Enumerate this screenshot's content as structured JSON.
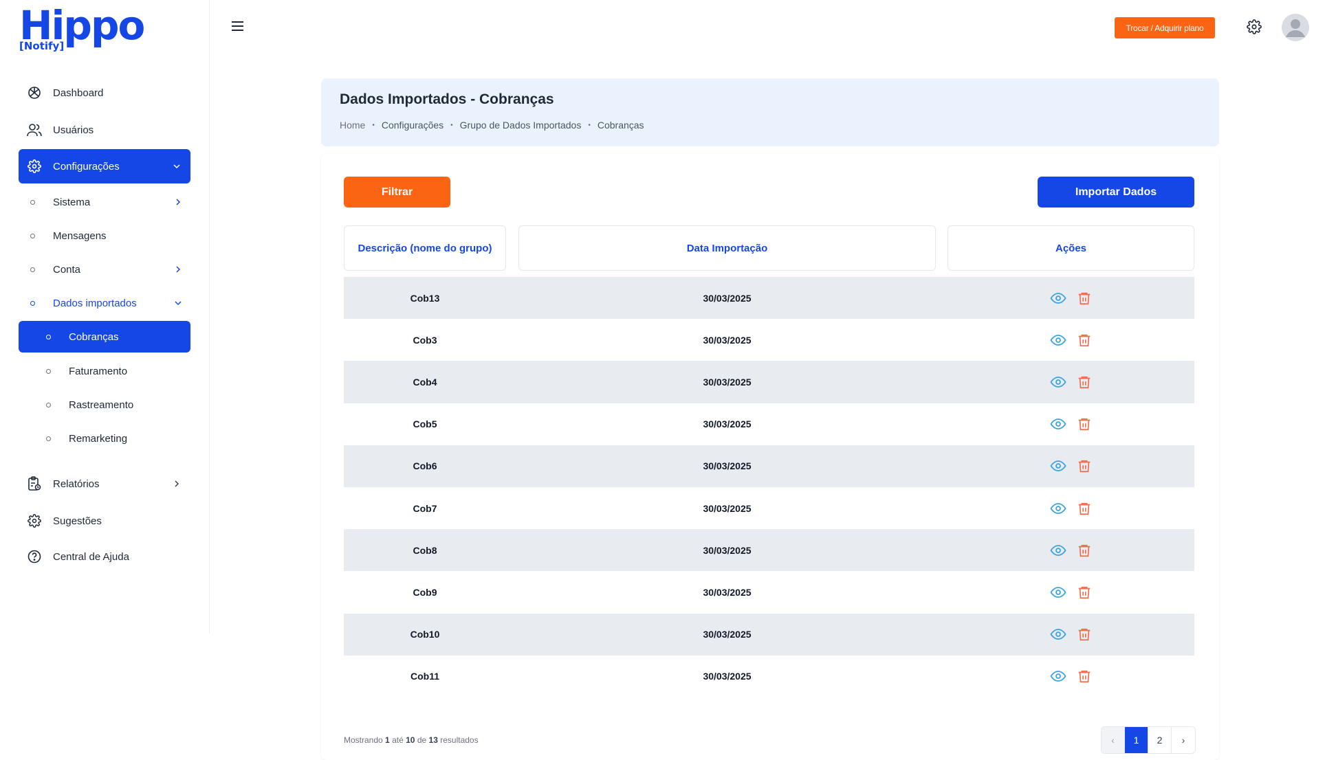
{
  "logo": {
    "main": "Hippo",
    "sub": "[Notify]"
  },
  "sidebar": {
    "items": [
      {
        "label": "Dashboard",
        "icon": "dashboard-icon"
      },
      {
        "label": "Usuários",
        "icon": "users-icon"
      },
      {
        "label": "Configurações",
        "icon": "gear-icon",
        "active": true,
        "expanded": true
      },
      {
        "label": "Relatórios",
        "icon": "report-icon"
      },
      {
        "label": "Sugestões",
        "icon": "suggestion-gear-icon"
      },
      {
        "label": "Central de Ajuda",
        "icon": "help-icon"
      }
    ],
    "config_sub": [
      {
        "label": "Sistema"
      },
      {
        "label": "Mensagens"
      },
      {
        "label": "Conta"
      },
      {
        "label": "Dados importados",
        "expanded": true
      }
    ],
    "imported_sub": [
      {
        "label": "Cobranças",
        "active": true
      },
      {
        "label": "Faturamento"
      },
      {
        "label": "Rastreamento"
      },
      {
        "label": "Remarketing"
      }
    ]
  },
  "topbar": {
    "upgrade_label": "Trocar / Adquirir plano"
  },
  "header": {
    "title": "Dados Importados - Cobranças",
    "breadcrumb": [
      "Home",
      "Configurações",
      "Grupo de Dados Importados",
      "Cobranças"
    ]
  },
  "actions": {
    "filter_label": "Filtrar",
    "import_label": "Importar Dados"
  },
  "table": {
    "headers": [
      "Descrição (nome do grupo)",
      "Data Importação",
      "Ações"
    ],
    "rows": [
      {
        "name": "Cob13",
        "date": "30/03/2025"
      },
      {
        "name": "Cob3",
        "date": "30/03/2025"
      },
      {
        "name": "Cob4",
        "date": "30/03/2025"
      },
      {
        "name": "Cob5",
        "date": "30/03/2025"
      },
      {
        "name": "Cob6",
        "date": "30/03/2025"
      },
      {
        "name": "Cob7",
        "date": "30/03/2025"
      },
      {
        "name": "Cob8",
        "date": "30/03/2025"
      },
      {
        "name": "Cob9",
        "date": "30/03/2025"
      },
      {
        "name": "Cob10",
        "date": "30/03/2025"
      },
      {
        "name": "Cob11",
        "date": "30/03/2025"
      }
    ]
  },
  "pagination": {
    "showing_prefix": "Mostrando",
    "from": "1",
    "to_word": "até",
    "to": "10",
    "of_word": "de",
    "total": "13",
    "suffix": "resultados",
    "prev": "‹",
    "pages": [
      "1",
      "2"
    ],
    "current": "1",
    "next": "›"
  },
  "colors": {
    "primary": "#1447e6",
    "accent": "#fb6413",
    "eye": "#3aa3e3",
    "trash": "#ef6b4a",
    "row_alt": "#e8ecf1",
    "header_bg": "#eaf2fd"
  }
}
